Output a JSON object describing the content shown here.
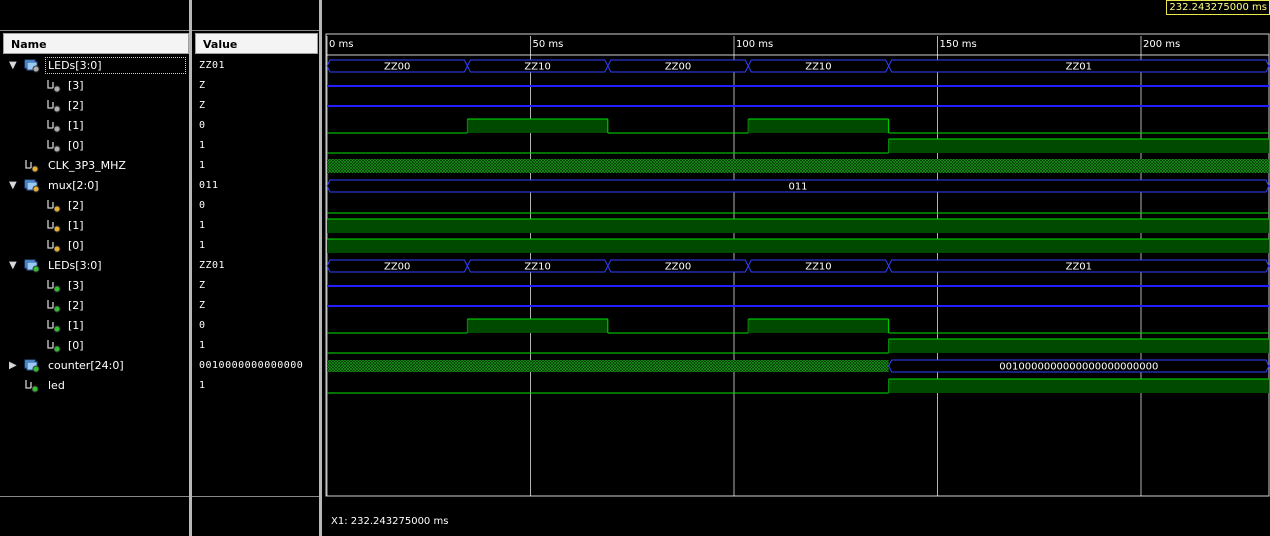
{
  "columns": {
    "name_header": "Name",
    "value_header": "Value"
  },
  "cursor": {
    "readout": "232.243275000 ms",
    "status": "X1: 232.243275000 ms"
  },
  "time_axis": {
    "unit": "ms",
    "labels": [
      "0 ms",
      "50 ms",
      "100 ms",
      "150 ms",
      "200 ms"
    ],
    "values": [
      0,
      50,
      100,
      150,
      200
    ]
  },
  "signals": [
    {
      "name": "LEDs[3:0]",
      "value": "ZZ01",
      "level": 0,
      "expander": "expanded",
      "icon": "bus-icon-out",
      "wave": {
        "type": "bus",
        "segments": [
          {
            "start": 0,
            "end": 34.5,
            "label": "ZZ00"
          },
          {
            "start": 34.5,
            "end": 69,
            "label": "ZZ10"
          },
          {
            "start": 69,
            "end": 103.5,
            "label": "ZZ00"
          },
          {
            "start": 103.5,
            "end": 138,
            "label": "ZZ10"
          },
          {
            "start": 138,
            "end": 232.2,
            "label": "ZZ01"
          }
        ]
      }
    },
    {
      "name": "[3]",
      "value": "Z",
      "level": 1,
      "icon": "bit-icon-out",
      "wave": {
        "type": "z"
      }
    },
    {
      "name": "[2]",
      "value": "Z",
      "level": 1,
      "icon": "bit-icon-out",
      "wave": {
        "type": "z"
      }
    },
    {
      "name": "[1]",
      "value": "0",
      "level": 1,
      "icon": "bit-icon-out",
      "wave": {
        "type": "bit",
        "initial": 0,
        "toggles": [
          34.5,
          69,
          103.5,
          138
        ]
      }
    },
    {
      "name": "[0]",
      "value": "1",
      "level": 1,
      "icon": "bit-icon-out",
      "wave": {
        "type": "bit",
        "initial": 0,
        "toggles": [
          138
        ]
      }
    },
    {
      "name": "CLK_3P3_MHZ",
      "value": "1",
      "level": 0,
      "icon": "bit-icon-in",
      "wave": {
        "type": "clock"
      }
    },
    {
      "name": "mux[2:0]",
      "value": "011",
      "level": 0,
      "expander": "expanded",
      "icon": "bus-icon-in",
      "wave": {
        "type": "bus",
        "segments": [
          {
            "start": 0,
            "end": 232.2,
            "label": "011"
          }
        ]
      }
    },
    {
      "name": "[2]",
      "value": "0",
      "level": 1,
      "icon": "bit-icon-in",
      "wave": {
        "type": "bit",
        "initial": 0,
        "toggles": []
      }
    },
    {
      "name": "[1]",
      "value": "1",
      "level": 1,
      "icon": "bit-icon-in",
      "wave": {
        "type": "bit",
        "initial": 1,
        "toggles": []
      }
    },
    {
      "name": "[0]",
      "value": "1",
      "level": 1,
      "icon": "bit-icon-in",
      "wave": {
        "type": "bit",
        "initial": 1,
        "toggles": []
      }
    },
    {
      "name": "LEDs[3:0]",
      "value": "ZZ01",
      "level": 0,
      "expander": "expanded",
      "icon": "bus-icon-internal",
      "wave": {
        "type": "bus",
        "segments": [
          {
            "start": 0,
            "end": 34.5,
            "label": "ZZ00"
          },
          {
            "start": 34.5,
            "end": 69,
            "label": "ZZ10"
          },
          {
            "start": 69,
            "end": 103.5,
            "label": "ZZ00"
          },
          {
            "start": 103.5,
            "end": 138,
            "label": "ZZ10"
          },
          {
            "start": 138,
            "end": 232.2,
            "label": "ZZ01"
          }
        ]
      }
    },
    {
      "name": "[3]",
      "value": "Z",
      "level": 1,
      "icon": "bit-icon-internal",
      "wave": {
        "type": "z"
      }
    },
    {
      "name": "[2]",
      "value": "Z",
      "level": 1,
      "icon": "bit-icon-internal",
      "wave": {
        "type": "z"
      }
    },
    {
      "name": "[1]",
      "value": "0",
      "level": 1,
      "icon": "bit-icon-internal",
      "wave": {
        "type": "bit",
        "initial": 0,
        "toggles": [
          34.5,
          69,
          103.5,
          138
        ]
      }
    },
    {
      "name": "[0]",
      "value": "1",
      "level": 1,
      "icon": "bit-icon-internal",
      "wave": {
        "type": "bit",
        "initial": 0,
        "toggles": [
          138
        ]
      }
    },
    {
      "name": "counter[24:0]",
      "value": "0010000000000000",
      "level": 0,
      "expander": "collapsed",
      "icon": "bus-icon-internal",
      "wave": {
        "type": "hatchbus",
        "hatch_end": 138,
        "segments": [
          {
            "start": 138,
            "end": 232.2,
            "label": "0010000000000000000000000"
          }
        ]
      }
    },
    {
      "name": "led",
      "value": "1",
      "level": 0,
      "icon": "bit-icon-internal",
      "wave": {
        "type": "bit",
        "initial": 0,
        "toggles": [
          138
        ]
      }
    }
  ],
  "colors": {
    "bit_line": "#00e000",
    "high_fill": "#004a00",
    "z_line": "#2020ff",
    "bus_line": "#3040ff",
    "grid": "#ffffff",
    "bg": "#000000"
  }
}
